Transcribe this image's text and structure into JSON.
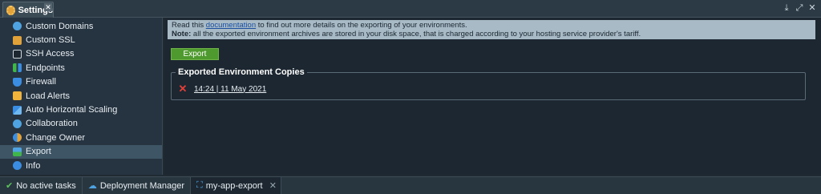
{
  "window": {
    "tab_title": "Settings",
    "tab_close": "✕",
    "controls": [
      {
        "name": "download-icon",
        "glyph": "⤓"
      },
      {
        "name": "expand-icon",
        "glyph": "⤢"
      },
      {
        "name": "close-icon",
        "glyph": "✕"
      }
    ]
  },
  "sidebar": {
    "items": [
      {
        "label": "Custom Domains",
        "icon": "globe-icon",
        "color": "#4fa3e0"
      },
      {
        "label": "Custom SSL",
        "icon": "certificate-icon",
        "color": "#e2a23a"
      },
      {
        "label": "SSH Access",
        "icon": "terminal-icon",
        "color": "#cfd7dd"
      },
      {
        "label": "Endpoints",
        "icon": "endpoints-icon",
        "color": "#3fb54b"
      },
      {
        "label": "Firewall",
        "icon": "shield-icon",
        "color": "#3a8de0"
      },
      {
        "label": "Load Alerts",
        "icon": "alert-icon",
        "color": "#f0b43c"
      },
      {
        "label": "Auto Horizontal Scaling",
        "icon": "scaling-icon",
        "color": "#3a8de0"
      },
      {
        "label": "Collaboration",
        "icon": "collaboration-icon",
        "color": "#4fa3e0"
      },
      {
        "label": "Change Owner",
        "icon": "change-owner-icon",
        "color": "#e2a23a"
      },
      {
        "label": "Export",
        "icon": "export-icon",
        "color": "#4fa3e0",
        "active": true
      },
      {
        "label": "Info",
        "icon": "info-icon",
        "color": "#3a8de0"
      }
    ]
  },
  "notice": {
    "line1_before": "Read this",
    "link": "documentation",
    "line1_after": "to find out more details on the exporting of your environments.",
    "note_label": "Note:",
    "line2": "all the exported environment archives are stored in your disk space, that is charged according to your hosting service provider's tariff."
  },
  "export_button": "Export",
  "copies": {
    "legend": "Exported Environment Copies",
    "items": [
      {
        "label": "14:24 | 11 May 2021"
      }
    ]
  },
  "taskbar": {
    "items": [
      {
        "label": "No active tasks",
        "glyph": "✔",
        "color": "#5cc15c"
      },
      {
        "label": "Deployment Manager",
        "glyph": "☁",
        "color": "#4fa3e0"
      },
      {
        "label": "my-app-export",
        "glyph": "⛶",
        "color": "#4fa3e0",
        "active": true
      }
    ],
    "close": "✕"
  }
}
